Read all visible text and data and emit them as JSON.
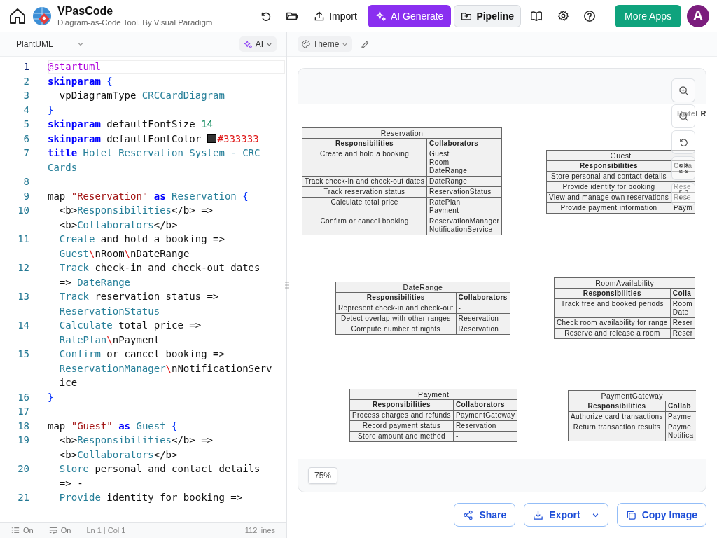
{
  "app": {
    "title": "VPasCode",
    "subtitle": "Diagram-as-Code Tool. By Visual Paradigm"
  },
  "toolbar": {
    "import": "Import",
    "ai_generate": "AI Generate",
    "pipeline": "Pipeline",
    "more_apps": "More Apps",
    "avatar": "A"
  },
  "editor": {
    "language": "PlantUML",
    "ai": "AI",
    "lines": [
      {
        "number": "1",
        "active": true,
        "visual_rows": [
          {
            "tokens": [
              {
                "kind": "directive",
                "text": "@startuml"
              }
            ]
          }
        ]
      },
      {
        "number": "2",
        "active": false,
        "visual_rows": [
          {
            "tokens": [
              {
                "kind": "keyword",
                "text": "skinparam"
              },
              {
                "kind": "brace",
                "text": " {"
              }
            ]
          }
        ]
      },
      {
        "number": "3",
        "active": false,
        "visual_rows": [
          {
            "tokens": [
              {
                "kind": "plain",
                "text": "  vpDiagramType "
              },
              {
                "kind": "identifier",
                "text": "CRCCardDiagram"
              }
            ]
          }
        ]
      },
      {
        "number": "4",
        "active": false,
        "visual_rows": [
          {
            "tokens": [
              {
                "kind": "brace",
                "text": "}"
              }
            ]
          }
        ]
      },
      {
        "number": "5",
        "active": false,
        "visual_rows": [
          {
            "tokens": [
              {
                "kind": "keyword",
                "text": "skinparam"
              },
              {
                "kind": "plain",
                "text": " defaultFontSize "
              },
              {
                "kind": "number",
                "text": "14"
              }
            ]
          }
        ]
      },
      {
        "number": "6",
        "active": false,
        "visual_rows": [
          {
            "tokens": [
              {
                "kind": "keyword",
                "text": "skinparam"
              },
              {
                "kind": "plain",
                "text": " defaultFontColor "
              },
              {
                "kind": "swatch",
                "color": "#333333"
              },
              {
                "kind": "escape",
                "text": "#333333"
              }
            ]
          }
        ]
      },
      {
        "number": "7",
        "active": false,
        "visual_rows": [
          {
            "tokens": [
              {
                "kind": "keyword",
                "text": "title"
              },
              {
                "kind": "identifier",
                "text": " Hotel Reservation System - CRC"
              }
            ]
          },
          {
            "tokens": [
              {
                "kind": "identifier",
                "text": "Cards"
              }
            ]
          }
        ]
      },
      {
        "number": "8",
        "active": false
      },
      {
        "number": "9",
        "active": false,
        "visual_rows": [
          {
            "tokens": [
              {
                "kind": "plain",
                "text": "map "
              },
              {
                "kind": "string",
                "text": "\"Reservation\""
              },
              {
                "kind": "keyword",
                "text": " as"
              },
              {
                "kind": "identifier",
                "text": " Reservation"
              },
              {
                "kind": "brace",
                "text": " {"
              }
            ]
          }
        ]
      },
      {
        "number": "10",
        "active": false,
        "visual_rows": [
          {
            "tokens": [
              {
                "kind": "plain",
                "text": "  <b>"
              },
              {
                "kind": "identifier",
                "text": "Responsibilities"
              },
              {
                "kind": "plain",
                "text": "</b> =>"
              }
            ]
          },
          {
            "tokens": [
              {
                "kind": "plain",
                "text": "  <b>"
              },
              {
                "kind": "identifier",
                "text": "Collaborators"
              },
              {
                "kind": "plain",
                "text": "</b>"
              }
            ]
          }
        ]
      },
      {
        "number": "11",
        "active": false,
        "visual_rows": [
          {
            "tokens": [
              {
                "kind": "identifier",
                "text": "  Create"
              },
              {
                "kind": "plain",
                "text": " and hold a booking =>"
              }
            ]
          },
          {
            "tokens": [
              {
                "kind": "identifier",
                "text": "  Guest"
              },
              {
                "kind": "escape",
                "text": "\\"
              },
              {
                "kind": "plain",
                "text": "nRoom"
              },
              {
                "kind": "escape",
                "text": "\\"
              },
              {
                "kind": "plain",
                "text": "nDateRange"
              }
            ]
          }
        ]
      },
      {
        "number": "12",
        "active": false,
        "visual_rows": [
          {
            "tokens": [
              {
                "kind": "identifier",
                "text": "  Track"
              },
              {
                "kind": "plain",
                "text": " check-in and check-out dates"
              }
            ]
          },
          {
            "tokens": [
              {
                "kind": "plain",
                "text": "  =>"
              },
              {
                "kind": "identifier",
                "text": " DateRange"
              }
            ]
          }
        ]
      },
      {
        "number": "13",
        "active": false,
        "visual_rows": [
          {
            "tokens": [
              {
                "kind": "identifier",
                "text": "  Track"
              },
              {
                "kind": "plain",
                "text": " reservation status =>"
              }
            ]
          },
          {
            "tokens": [
              {
                "kind": "identifier",
                "text": "  ReservationStatus"
              }
            ]
          }
        ]
      },
      {
        "number": "14",
        "active": false,
        "visual_rows": [
          {
            "tokens": [
              {
                "kind": "identifier",
                "text": "  Calculate"
              },
              {
                "kind": "plain",
                "text": " total price =>"
              }
            ]
          },
          {
            "tokens": [
              {
                "kind": "identifier",
                "text": "  RatePlan"
              },
              {
                "kind": "escape",
                "text": "\\"
              },
              {
                "kind": "plain",
                "text": "nPayment"
              }
            ]
          }
        ]
      },
      {
        "number": "15",
        "active": false,
        "visual_rows": [
          {
            "tokens": [
              {
                "kind": "identifier",
                "text": "  Confirm"
              },
              {
                "kind": "plain",
                "text": " or cancel booking =>"
              }
            ]
          },
          {
            "tokens": [
              {
                "kind": "identifier",
                "text": "  ReservationManager"
              },
              {
                "kind": "escape",
                "text": "\\"
              },
              {
                "kind": "plain",
                "text": "nNotificationServ"
              }
            ]
          },
          {
            "tokens": [
              {
                "kind": "plain",
                "text": "  ice"
              }
            ]
          }
        ]
      },
      {
        "number": "16",
        "active": false,
        "visual_rows": [
          {
            "tokens": [
              {
                "kind": "brace",
                "text": "}"
              }
            ]
          }
        ]
      },
      {
        "number": "17",
        "active": false
      },
      {
        "number": "18",
        "active": false,
        "visual_rows": [
          {
            "tokens": [
              {
                "kind": "plain",
                "text": "map "
              },
              {
                "kind": "string",
                "text": "\"Guest\""
              },
              {
                "kind": "keyword",
                "text": " as"
              },
              {
                "kind": "identifier",
                "text": " Guest"
              },
              {
                "kind": "brace",
                "text": " {"
              }
            ]
          }
        ]
      },
      {
        "number": "19",
        "active": false,
        "visual_rows": [
          {
            "tokens": [
              {
                "kind": "plain",
                "text": "  <b>"
              },
              {
                "kind": "identifier",
                "text": "Responsibilities"
              },
              {
                "kind": "plain",
                "text": "</b> =>"
              }
            ]
          },
          {
            "tokens": [
              {
                "kind": "plain",
                "text": "  <b>"
              },
              {
                "kind": "identifier",
                "text": "Collaborators"
              },
              {
                "kind": "plain",
                "text": "</b>"
              }
            ]
          }
        ]
      },
      {
        "number": "20",
        "active": false,
        "visual_rows": [
          {
            "tokens": [
              {
                "kind": "identifier",
                "text": "  Store"
              },
              {
                "kind": "plain",
                "text": " personal and contact details"
              }
            ]
          },
          {
            "tokens": [
              {
                "kind": "plain",
                "text": "  => -"
              }
            ]
          }
        ]
      },
      {
        "number": "21",
        "active": false,
        "visual_rows": [
          {
            "tokens": [
              {
                "kind": "identifier",
                "text": "  Provide"
              },
              {
                "kind": "plain",
                "text": " identity for booking =>"
              }
            ]
          }
        ]
      }
    ],
    "status": {
      "line_numbers": "On",
      "wrap": "On",
      "cursor": "Ln 1 | Col 1",
      "count": "112 lines"
    }
  },
  "preview": {
    "theme": "Theme",
    "diagram_title": "Hotel R",
    "cards": [
      {
        "name": "Reservation",
        "cut": false,
        "headers": [
          "Responsibilities",
          "Collaborators"
        ],
        "rows": [
          {
            "responsibility": "Create and hold a booking",
            "collaborators": [
              "Guest",
              "Room",
              "DateRange"
            ]
          },
          {
            "responsibility": "Track check-in and check-out dates",
            "collaborators": [
              "DateRange"
            ]
          },
          {
            "responsibility": "Track reservation status",
            "collaborators": [
              "ReservationStatus"
            ]
          },
          {
            "responsibility": "Calculate total price",
            "collaborators": [
              "RatePlan",
              "Payment"
            ]
          },
          {
            "responsibility": "Confirm or cancel booking",
            "collaborators": [
              "ReservationManager",
              "NotificationService"
            ]
          }
        ]
      },
      {
        "name": "Guest",
        "cut": true,
        "headers": [
          "Responsibilities",
          "Colla"
        ],
        "rows": [
          {
            "responsibility": "Store personal and contact details",
            "collaborators": [
              "-"
            ]
          },
          {
            "responsibility": "Provide identity for booking",
            "collaborators": [
              "Rese"
            ]
          },
          {
            "responsibility": "View and manage own reservations",
            "collaborators": [
              "Rese"
            ]
          },
          {
            "responsibility": "Provide payment information",
            "collaborators": [
              "Paym"
            ]
          }
        ]
      },
      {
        "name": "DateRange",
        "cut": false,
        "headers": [
          "Responsibilities",
          "Collaborators"
        ],
        "rows": [
          {
            "responsibility": "Represent check-in and check-out",
            "collaborators": [
              "-"
            ]
          },
          {
            "responsibility": "Detect overlap with other ranges",
            "collaborators": [
              "Reservation"
            ]
          },
          {
            "responsibility": "Compute number of nights",
            "collaborators": [
              "Reservation"
            ]
          }
        ]
      },
      {
        "name": "RoomAvailability",
        "cut": true,
        "headers": [
          "Responsibilities",
          "Colla"
        ],
        "rows": [
          {
            "responsibility": "Track free and booked periods",
            "collaborators": [
              "Room",
              "Date"
            ]
          },
          {
            "responsibility": "Check room availability for range",
            "collaborators": [
              "Reser"
            ]
          },
          {
            "responsibility": "Reserve and release a room",
            "collaborators": [
              "Reser"
            ]
          }
        ]
      },
      {
        "name": "Payment",
        "cut": false,
        "headers": [
          "Responsibilities",
          "Collaborators"
        ],
        "rows": [
          {
            "responsibility": "Process charges and refunds",
            "collaborators": [
              "PaymentGateway"
            ]
          },
          {
            "responsibility": "Record payment status",
            "collaborators": [
              "Reservation"
            ]
          },
          {
            "responsibility": "Store amount and method",
            "collaborators": [
              "-"
            ]
          }
        ]
      },
      {
        "name": "PaymentGateway",
        "cut": true,
        "headers": [
          "Responsibilities",
          "Collab"
        ],
        "rows": [
          {
            "responsibility": "Authorize card transactions",
            "collaborators": [
              "Payme"
            ]
          },
          {
            "responsibility": "Return transaction results",
            "collaborators": [
              "Payme",
              "Notifica"
            ]
          }
        ]
      }
    ],
    "zoom": "75%"
  },
  "actions": {
    "share": "Share",
    "export": "Export",
    "copy": "Copy Image"
  }
}
